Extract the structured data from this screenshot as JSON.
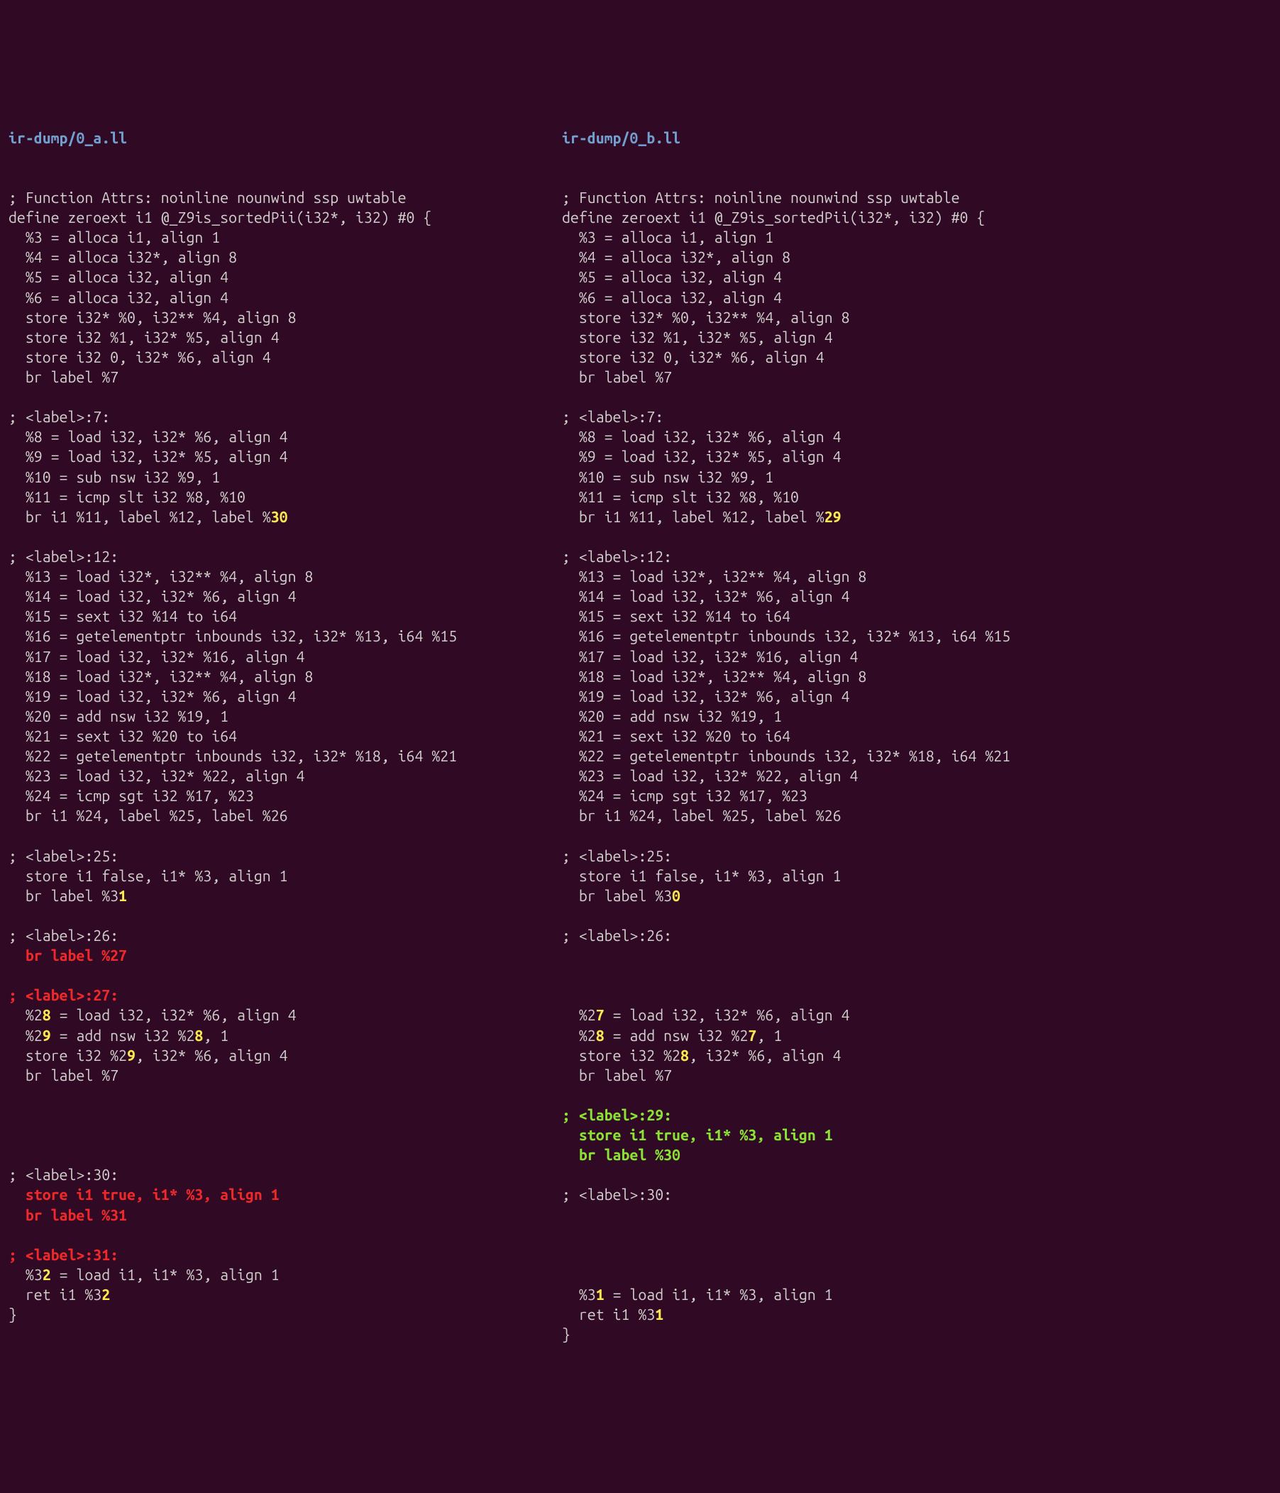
{
  "left": {
    "header": "ir-dump/0_a.ll",
    "lines": [
      {
        "type": "plain",
        "text": "; Function Attrs: noinline nounwind ssp uwtable"
      },
      {
        "type": "plain",
        "text": "define zeroext i1 @_Z9is_sortedPii(i32*, i32) #0 {"
      },
      {
        "type": "plain",
        "text": "  %3 = alloca i1, align 1"
      },
      {
        "type": "plain",
        "text": "  %4 = alloca i32*, align 8"
      },
      {
        "type": "plain",
        "text": "  %5 = alloca i32, align 4"
      },
      {
        "type": "plain",
        "text": "  %6 = alloca i32, align 4"
      },
      {
        "type": "plain",
        "text": "  store i32* %0, i32** %4, align 8"
      },
      {
        "type": "plain",
        "text": "  store i32 %1, i32* %5, align 4"
      },
      {
        "type": "plain",
        "text": "  store i32 0, i32* %6, align 4"
      },
      {
        "type": "plain",
        "text": "  br label %7"
      },
      {
        "type": "blank"
      },
      {
        "type": "plain",
        "text": "; <label>:7:"
      },
      {
        "type": "plain",
        "text": "  %8 = load i32, i32* %6, align 4"
      },
      {
        "type": "plain",
        "text": "  %9 = load i32, i32* %5, align 4"
      },
      {
        "type": "plain",
        "text": "  %10 = sub nsw i32 %9, 1"
      },
      {
        "type": "plain",
        "text": "  %11 = icmp slt i32 %8, %10"
      },
      {
        "type": "segments",
        "segs": [
          {
            "t": "  br i1 %11, label %12, label %"
          },
          {
            "t": "30",
            "c": "hl-y"
          }
        ]
      },
      {
        "type": "blank"
      },
      {
        "type": "plain",
        "text": "; <label>:12:"
      },
      {
        "type": "plain",
        "text": "  %13 = load i32*, i32** %4, align 8"
      },
      {
        "type": "plain",
        "text": "  %14 = load i32, i32* %6, align 4"
      },
      {
        "type": "plain",
        "text": "  %15 = sext i32 %14 to i64"
      },
      {
        "type": "plain",
        "text": "  %16 = getelementptr inbounds i32, i32* %13, i64 %15"
      },
      {
        "type": "plain",
        "text": "  %17 = load i32, i32* %16, align 4"
      },
      {
        "type": "plain",
        "text": "  %18 = load i32*, i32** %4, align 8"
      },
      {
        "type": "plain",
        "text": "  %19 = load i32, i32* %6, align 4"
      },
      {
        "type": "plain",
        "text": "  %20 = add nsw i32 %19, 1"
      },
      {
        "type": "plain",
        "text": "  %21 = sext i32 %20 to i64"
      },
      {
        "type": "plain",
        "text": "  %22 = getelementptr inbounds i32, i32* %18, i64 %21"
      },
      {
        "type": "plain",
        "text": "  %23 = load i32, i32* %22, align 4"
      },
      {
        "type": "plain",
        "text": "  %24 = icmp sgt i32 %17, %23"
      },
      {
        "type": "plain",
        "text": "  br i1 %24, label %25, label %26"
      },
      {
        "type": "blank"
      },
      {
        "type": "plain",
        "text": "; <label>:25:"
      },
      {
        "type": "plain",
        "text": "  store i1 false, i1* %3, align 1"
      },
      {
        "type": "segments",
        "segs": [
          {
            "t": "  br label %3"
          },
          {
            "t": "1",
            "c": "hl-y"
          }
        ]
      },
      {
        "type": "blank"
      },
      {
        "type": "plain",
        "text": "; <label>:26:"
      },
      {
        "type": "segments",
        "segs": [
          {
            "t": "  br label %27",
            "c": "hl-r"
          }
        ]
      },
      {
        "type": "blank"
      },
      {
        "type": "segments",
        "segs": [
          {
            "t": "; <label>:27:",
            "c": "hl-r"
          }
        ]
      },
      {
        "type": "segments",
        "segs": [
          {
            "t": "  %2"
          },
          {
            "t": "8",
            "c": "hl-y"
          },
          {
            "t": " = load i32, i32* %6, align 4"
          }
        ]
      },
      {
        "type": "segments",
        "segs": [
          {
            "t": "  %2"
          },
          {
            "t": "9",
            "c": "hl-y"
          },
          {
            "t": " = add nsw i32 %2"
          },
          {
            "t": "8",
            "c": "hl-y"
          },
          {
            "t": ", 1"
          }
        ]
      },
      {
        "type": "segments",
        "segs": [
          {
            "t": "  store i32 %2"
          },
          {
            "t": "9",
            "c": "hl-y"
          },
          {
            "t": ", i32* %6, align 4"
          }
        ]
      },
      {
        "type": "plain",
        "text": "  br label %7"
      },
      {
        "type": "blank"
      },
      {
        "type": "blank"
      },
      {
        "type": "blank"
      },
      {
        "type": "blank"
      },
      {
        "type": "plain",
        "text": "; <label>:30:"
      },
      {
        "type": "segments",
        "segs": [
          {
            "t": "  store i1 true, i1* %3, align 1",
            "c": "hl-r"
          }
        ]
      },
      {
        "type": "segments",
        "segs": [
          {
            "t": "  br label %31",
            "c": "hl-r"
          }
        ]
      },
      {
        "type": "blank"
      },
      {
        "type": "segments",
        "segs": [
          {
            "t": "; <label>:31:",
            "c": "hl-r"
          }
        ]
      },
      {
        "type": "segments",
        "segs": [
          {
            "t": "  %3"
          },
          {
            "t": "2",
            "c": "hl-y"
          },
          {
            "t": " = load i1, i1* %3, align 1"
          }
        ]
      },
      {
        "type": "segments",
        "segs": [
          {
            "t": "  ret i1 %3"
          },
          {
            "t": "2",
            "c": "hl-y"
          }
        ]
      },
      {
        "type": "plain",
        "text": "}"
      }
    ]
  },
  "right": {
    "header": "ir-dump/0_b.ll",
    "lines": [
      {
        "type": "plain",
        "text": "; Function Attrs: noinline nounwind ssp uwtable"
      },
      {
        "type": "plain",
        "text": "define zeroext i1 @_Z9is_sortedPii(i32*, i32) #0 {"
      },
      {
        "type": "plain",
        "text": "  %3 = alloca i1, align 1"
      },
      {
        "type": "plain",
        "text": "  %4 = alloca i32*, align 8"
      },
      {
        "type": "plain",
        "text": "  %5 = alloca i32, align 4"
      },
      {
        "type": "plain",
        "text": "  %6 = alloca i32, align 4"
      },
      {
        "type": "plain",
        "text": "  store i32* %0, i32** %4, align 8"
      },
      {
        "type": "plain",
        "text": "  store i32 %1, i32* %5, align 4"
      },
      {
        "type": "plain",
        "text": "  store i32 0, i32* %6, align 4"
      },
      {
        "type": "plain",
        "text": "  br label %7"
      },
      {
        "type": "blank"
      },
      {
        "type": "plain",
        "text": "; <label>:7:"
      },
      {
        "type": "plain",
        "text": "  %8 = load i32, i32* %6, align 4"
      },
      {
        "type": "plain",
        "text": "  %9 = load i32, i32* %5, align 4"
      },
      {
        "type": "plain",
        "text": "  %10 = sub nsw i32 %9, 1"
      },
      {
        "type": "plain",
        "text": "  %11 = icmp slt i32 %8, %10"
      },
      {
        "type": "segments",
        "segs": [
          {
            "t": "  br i1 %11, label %12, label %"
          },
          {
            "t": "29",
            "c": "hl-y"
          }
        ]
      },
      {
        "type": "blank"
      },
      {
        "type": "plain",
        "text": "; <label>:12:"
      },
      {
        "type": "plain",
        "text": "  %13 = load i32*, i32** %4, align 8"
      },
      {
        "type": "plain",
        "text": "  %14 = load i32, i32* %6, align 4"
      },
      {
        "type": "plain",
        "text": "  %15 = sext i32 %14 to i64"
      },
      {
        "type": "plain",
        "text": "  %16 = getelementptr inbounds i32, i32* %13, i64 %15"
      },
      {
        "type": "plain",
        "text": "  %17 = load i32, i32* %16, align 4"
      },
      {
        "type": "plain",
        "text": "  %18 = load i32*, i32** %4, align 8"
      },
      {
        "type": "plain",
        "text": "  %19 = load i32, i32* %6, align 4"
      },
      {
        "type": "plain",
        "text": "  %20 = add nsw i32 %19, 1"
      },
      {
        "type": "plain",
        "text": "  %21 = sext i32 %20 to i64"
      },
      {
        "type": "plain",
        "text": "  %22 = getelementptr inbounds i32, i32* %18, i64 %21"
      },
      {
        "type": "plain",
        "text": "  %23 = load i32, i32* %22, align 4"
      },
      {
        "type": "plain",
        "text": "  %24 = icmp sgt i32 %17, %23"
      },
      {
        "type": "plain",
        "text": "  br i1 %24, label %25, label %26"
      },
      {
        "type": "blank"
      },
      {
        "type": "plain",
        "text": "; <label>:25:"
      },
      {
        "type": "plain",
        "text": "  store i1 false, i1* %3, align 1"
      },
      {
        "type": "segments",
        "segs": [
          {
            "t": "  br label %3"
          },
          {
            "t": "0",
            "c": "hl-y"
          }
        ]
      },
      {
        "type": "blank"
      },
      {
        "type": "plain",
        "text": "; <label>:26:"
      },
      {
        "type": "blank"
      },
      {
        "type": "blank"
      },
      {
        "type": "blank"
      },
      {
        "type": "segments",
        "segs": [
          {
            "t": "  %2"
          },
          {
            "t": "7",
            "c": "hl-y"
          },
          {
            "t": " = load i32, i32* %6, align 4"
          }
        ]
      },
      {
        "type": "segments",
        "segs": [
          {
            "t": "  %2"
          },
          {
            "t": "8",
            "c": "hl-y"
          },
          {
            "t": " = add nsw i32 %2"
          },
          {
            "t": "7",
            "c": "hl-y"
          },
          {
            "t": ", 1"
          }
        ]
      },
      {
        "type": "segments",
        "segs": [
          {
            "t": "  store i32 %2"
          },
          {
            "t": "8",
            "c": "hl-y"
          },
          {
            "t": ", i32* %6, align 4"
          }
        ]
      },
      {
        "type": "plain",
        "text": "  br label %7"
      },
      {
        "type": "blank"
      },
      {
        "type": "segments",
        "segs": [
          {
            "t": "; <label>:29:",
            "c": "hl-g"
          }
        ]
      },
      {
        "type": "segments",
        "segs": [
          {
            "t": "  store i1 true, i1* %3, align 1",
            "c": "hl-g"
          }
        ]
      },
      {
        "type": "segments",
        "segs": [
          {
            "t": "  br label %30",
            "c": "hl-g"
          }
        ]
      },
      {
        "type": "blank"
      },
      {
        "type": "plain",
        "text": "; <label>:30:"
      },
      {
        "type": "blank"
      },
      {
        "type": "blank"
      },
      {
        "type": "blank"
      },
      {
        "type": "blank"
      },
      {
        "type": "segments",
        "segs": [
          {
            "t": "  %3"
          },
          {
            "t": "1",
            "c": "hl-y"
          },
          {
            "t": " = load i1, i1* %3, align 1"
          }
        ]
      },
      {
        "type": "segments",
        "segs": [
          {
            "t": "  ret i1 %3"
          },
          {
            "t": "1",
            "c": "hl-y"
          }
        ]
      },
      {
        "type": "plain",
        "text": "}"
      }
    ]
  }
}
